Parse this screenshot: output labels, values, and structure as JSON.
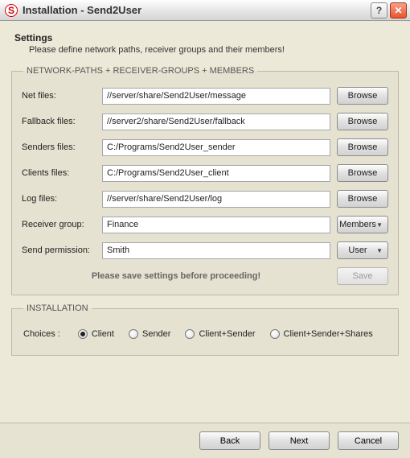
{
  "window": {
    "icon_letter": "S",
    "title": "Installation - Send2User"
  },
  "header": {
    "title": "Settings",
    "subtitle": "Please define network paths, receiver groups and their members!"
  },
  "paths_group": {
    "legend": "NETWORK-PATHS + RECEIVER-GROUPS + MEMBERS",
    "rows": {
      "net": {
        "label": "Net files:",
        "value": "//server/share/Send2User/message",
        "button": "Browse"
      },
      "fallback": {
        "label": "Fallback files:",
        "value": "//server2/share/Send2User/fallback",
        "button": "Browse"
      },
      "senders": {
        "label": "Senders files:",
        "value": "C:/Programs/Send2User_sender",
        "button": "Browse"
      },
      "clients": {
        "label": "Clients files:",
        "value": "C:/Programs/Send2User_client",
        "button": "Browse"
      },
      "log": {
        "label": "Log files:",
        "value": "//server/share/Send2User/log",
        "button": "Browse"
      },
      "group": {
        "label": "Receiver group:",
        "value": "Finance",
        "button": "Members"
      },
      "perm": {
        "label": "Send permission:",
        "value": "Smith",
        "button": "User"
      }
    },
    "hint": "Please save settings before proceeding!",
    "save_button": "Save"
  },
  "install_group": {
    "legend": "INSTALLATION",
    "choices_label": "Choices :",
    "options": {
      "client": "Client",
      "sender": "Sender",
      "client_sender": "Client+Sender",
      "client_sender_shares": "Client+Sender+Shares"
    },
    "selected": "client"
  },
  "footer": {
    "back": "Back",
    "next": "Next",
    "cancel": "Cancel"
  }
}
